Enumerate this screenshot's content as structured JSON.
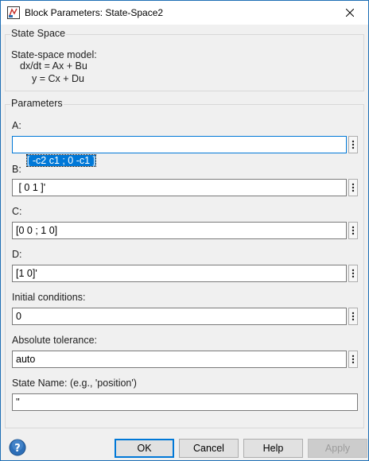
{
  "window": {
    "title": "Block Parameters: State-Space2"
  },
  "description_group": {
    "title": "State Space",
    "line1": "State-space model:",
    "line2": "dx/dt = Ax + Bu",
    "line3": "y = Cx + Du"
  },
  "parameters": {
    "title": "Parameters",
    "A": {
      "label": "A:",
      "value": "[ -c2 c1 ; 0 -c1 ]"
    },
    "B": {
      "label": "B:",
      "value": " [ 0 1 ]'"
    },
    "C": {
      "label": "C:",
      "value": "[0 0 ; 1 0]"
    },
    "D": {
      "label": "D:",
      "value": "[1 0]'"
    },
    "initial": {
      "label": "Initial conditions:",
      "value": "0"
    },
    "abstol": {
      "label": "Absolute tolerance:",
      "value": "auto"
    },
    "statename": {
      "label": "State Name: (e.g., 'position')",
      "value": "''"
    }
  },
  "buttons": {
    "ok": "OK",
    "cancel": "Cancel",
    "help": "Help",
    "apply": "Apply"
  },
  "icons": {
    "app": "simulink-block-icon",
    "close": "close-icon",
    "help": "help-icon",
    "more": "vertical-ellipsis-icon"
  },
  "colors": {
    "accent": "#0078d7",
    "help_icon": "#2d6fb8"
  }
}
